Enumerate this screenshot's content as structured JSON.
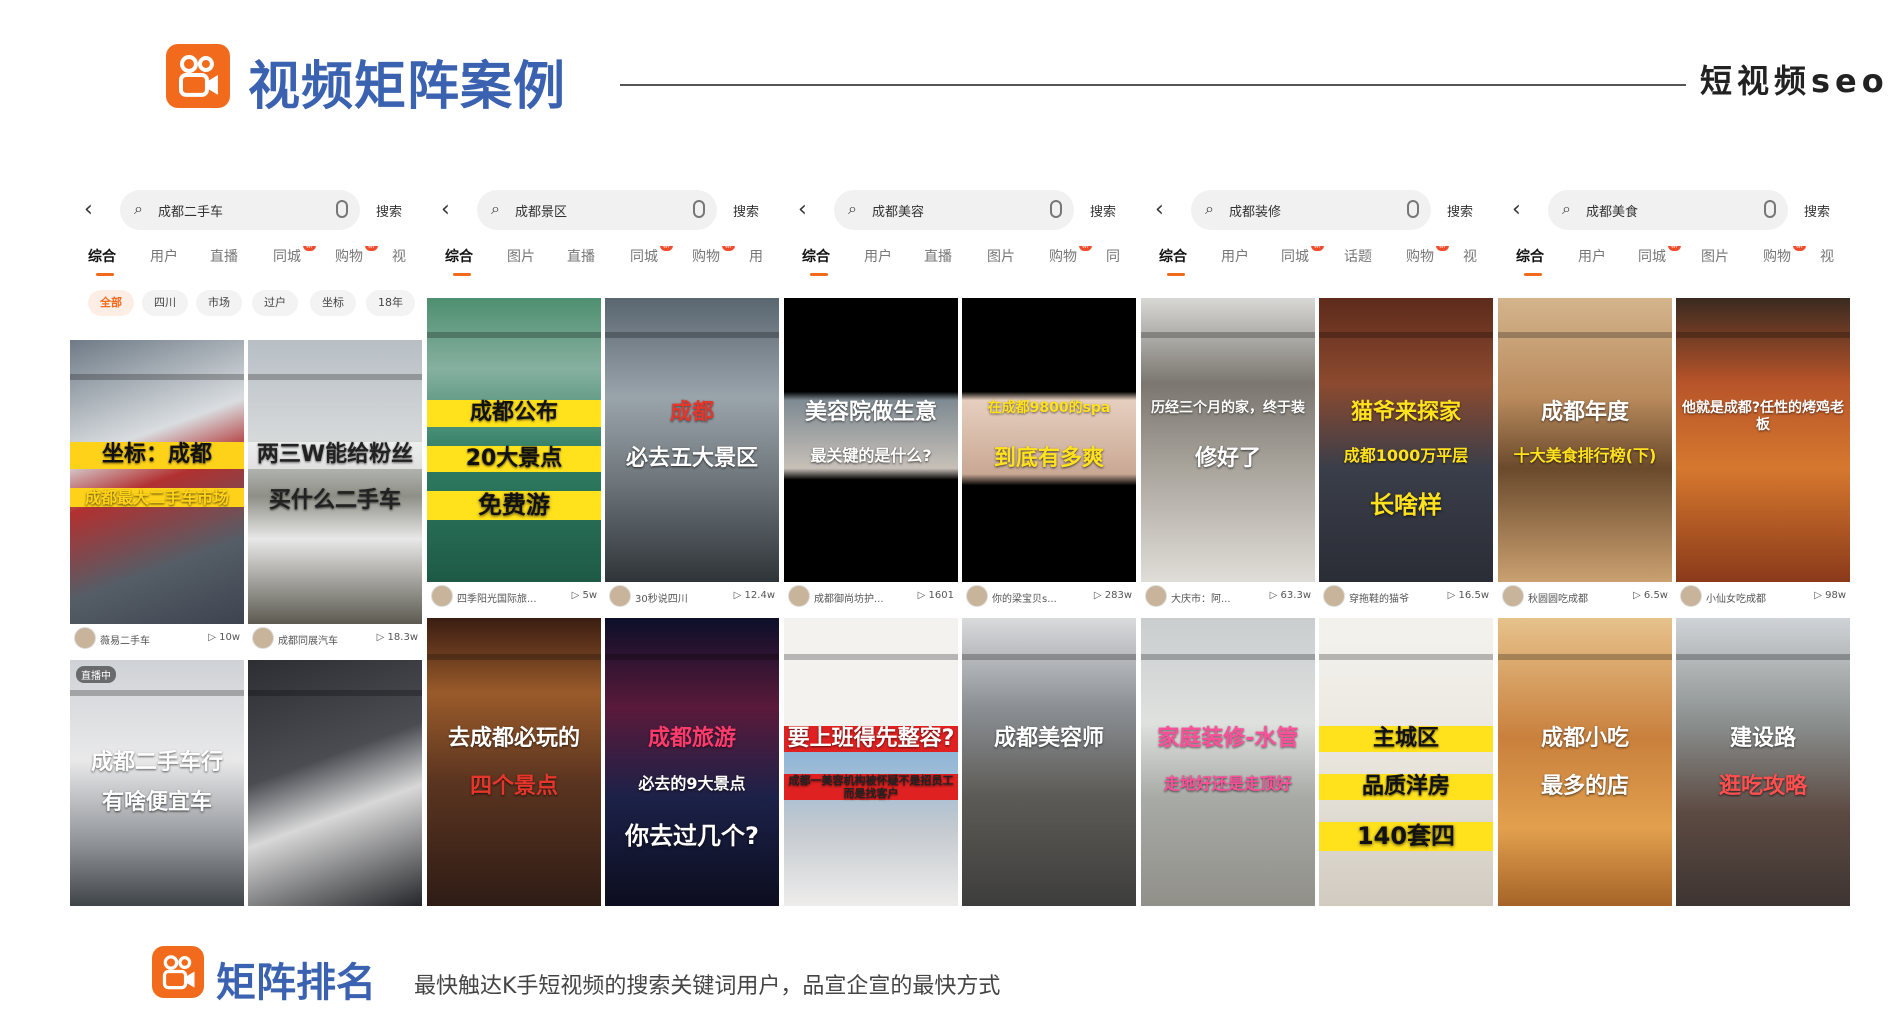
{
  "header": {
    "title": "视频矩阵案例",
    "right_text": "短视频seo"
  },
  "footer": {
    "title": "矩阵排名",
    "description": "最快触达K手短视频的搜索关键词用户，品宣企宣的最快方式"
  },
  "panels": [
    {
      "query": "成都二手车",
      "search_btn": "搜索",
      "tabs": [
        {
          "label": "综合",
          "active": true
        },
        {
          "label": "用户"
        },
        {
          "label": "直播"
        },
        {
          "label": "同城",
          "new": "新"
        },
        {
          "label": "购物",
          "new": "新"
        },
        {
          "label": "视"
        }
      ],
      "filters": [
        {
          "label": "全部",
          "active": true
        },
        {
          "label": "四川"
        },
        {
          "label": "市场"
        },
        {
          "label": "过户"
        },
        {
          "label": "坐标"
        },
        {
          "label": "18年"
        }
      ],
      "cards": [
        {
          "bg": "linear-gradient(160deg,#6e7a86,#d9dde0 35%,#b23030 50%,#555d66 75%,#3d4450)",
          "overlay": "坐标：成都",
          "overlay2": "成都最大二手车市场",
          "color": "#111",
          "color2": "#ffd21a",
          "hl": "#ffd21a",
          "author": "薇易二手车",
          "views": "10w"
        },
        {
          "bg": "linear-gradient(180deg,#b7bec4 0%,#d6d9da 35%,#8e8f86 55%,#e8e8e8 70%,#5c5a50)",
          "overlay": "两三W能给粉丝",
          "overlay2": "买什么二手车",
          "color": "#222",
          "color2": "#222",
          "hl": "rgba(255,255,255,0.6)",
          "author": "成都同展汽车",
          "views": "18.3w"
        },
        {
          "bg": "linear-gradient(180deg,#cfd2d6 0%,#e9e9ea 40%,#8a8e93 75%,#3a3f44)",
          "overlay": "成都二手车行",
          "overlay2": "有啥便宜车",
          "color": "#fff",
          "color2": "#fff",
          "hl": "rgba(0,0,0,0)",
          "author": "",
          "views": "",
          "live": "直播中"
        },
        {
          "bg": "linear-gradient(160deg,#2c2e33,#4a4c52 40%,#d8d8d8 60%,#1f2024)",
          "overlay": "",
          "overlay2": "",
          "color": "#fff",
          "color2": "#fff",
          "hl": "rgba(0,0,0,0)",
          "author": "",
          "views": ""
        }
      ]
    },
    {
      "query": "成都景区",
      "search_btn": "搜索",
      "tabs": [
        {
          "label": "综合",
          "active": true
        },
        {
          "label": "图片"
        },
        {
          "label": "直播"
        },
        {
          "label": "同城",
          "new": "新"
        },
        {
          "label": "购物",
          "new": "新"
        },
        {
          "label": "用"
        }
      ],
      "filters": [],
      "cards": [
        {
          "bg": "linear-gradient(180deg,#4e8f70 0%,#86b0a0 25%,#2f7e63 55%,#1e5a46)",
          "overlay": "成都公布",
          "overlay2": "20大景点",
          "overlay3": "免费游",
          "color": "#111",
          "color2": "#111",
          "hl": "#ffe11c",
          "author": "四季阳光国际旅...",
          "views": "5w"
        },
        {
          "bg": "linear-gradient(180deg,#5a6670 0%,#9aa4ab 35%,#6d757a 65%,#2f3438)",
          "overlay": "成都",
          "overlay2": "必去五大景区",
          "color": "#e4362b",
          "color2": "#fff",
          "hl": "rgba(0,0,0,0)",
          "author": "30秒说四川",
          "views": "12.4w"
        },
        {
          "bg": "linear-gradient(180deg,#3a1d12 0%,#9a5b2a 25%,#5a3420 55%,#2a1a14)",
          "overlay": "去成都必玩的",
          "overlay2": "四个景点",
          "color": "#fff",
          "color2": "#e4362b",
          "hl": "rgba(0,0,0,0)",
          "author": "",
          "views": ""
        },
        {
          "bg": "linear-gradient(180deg,#0c0f2a 0%,#5a1a3a 30%,#1c2148 60%,#0a0b1a)",
          "overlay": "成都旅游",
          "overlay2": "必去的9大景点",
          "overlay3": "你去过几个?",
          "color": "#ff3b6b",
          "color2": "#fff",
          "hl": "rgba(0,0,0,0)",
          "author": "",
          "views": ""
        }
      ]
    },
    {
      "query": "成都美容",
      "search_btn": "搜索",
      "tabs": [
        {
          "label": "综合",
          "active": true
        },
        {
          "label": "用户"
        },
        {
          "label": "直播"
        },
        {
          "label": "图片"
        },
        {
          "label": "购物",
          "new": "新"
        },
        {
          "label": "同"
        }
      ],
      "filters": [],
      "cards": [
        {
          "bg": "linear-gradient(180deg,#000 0%,#000 33%,#7e8a92 36%,#c7c0b8 60%,#000 64%,#000)",
          "overlay": "美容院做生意",
          "overlay2": "最关键的是什么?",
          "color": "#fff",
          "color2": "#fff",
          "hl": "rgba(0,0,0,0)",
          "author": "成都御尚坊护...",
          "views": "1601"
        },
        {
          "bg": "linear-gradient(180deg,#000 0%,#000 33%,#e6cfbf 36%,#c9a894 62%,#000 66%,#000)",
          "overlay": "在成都9800的spa",
          "overlay2": "到底有多爽",
          "color": "#ffe11c",
          "color2": "#ffe11c",
          "hl": "rgba(0,0,0,0)",
          "author": "你的梁宝贝s...",
          "views": "283w"
        },
        {
          "bg": "linear-gradient(180deg,#f4f2ef 0%,#f4f2ef 40%,#8fb6d8 45%,#c3c9cf 70%,#f4f2ef)",
          "overlay": "要上班得先整容?",
          "overlay2": "成都一美容机构被怀疑不是招员工而是找客户",
          "color": "#fff",
          "color2": "#222",
          "hl": "#e02121",
          "author": "",
          "views": ""
        },
        {
          "bg": "linear-gradient(180deg,#d9dadc 0%,#8b8f94 30%,#5c5a55 60%,#3a3a3a)",
          "overlay": "成都美容师",
          "overlay2": "",
          "color": "#fff",
          "color2": "#fff",
          "hl": "rgba(0,0,0,0)",
          "author": "",
          "views": ""
        }
      ]
    },
    {
      "query": "成都装修",
      "search_btn": "搜索",
      "tabs": [
        {
          "label": "综合",
          "active": true
        },
        {
          "label": "用户"
        },
        {
          "label": "同城",
          "new": "新"
        },
        {
          "label": "话题"
        },
        {
          "label": "购物",
          "new": "新"
        },
        {
          "label": "视"
        }
      ],
      "filters": [],
      "cards": [
        {
          "bg": "linear-gradient(180deg,#d8d8d6 0%,#7b7770 30%,#a9a49c 60%,#e0ddd8)",
          "overlay": "历经三个月的家，终于装",
          "overlay2": "修好了",
          "color": "#fff",
          "color2": "#fff",
          "hl": "rgba(0,0,0,0)",
          "author": "大庆市：阿...",
          "views": "63.3w"
        },
        {
          "bg": "linear-gradient(180deg,#5e2b1c 0%,#8c4a2f 30%,#3a3e4a 60%,#2a2d35)",
          "overlay": "猫爷来探家",
          "overlay2": "成都1000万平层",
          "overlay3": "长啥样",
          "color": "#ffe11c",
          "color2": "#ffe11c",
          "hl": "rgba(0,0,0,0)",
          "author": "穿拖鞋的猫爷",
          "views": "16.5w"
        },
        {
          "bg": "linear-gradient(180deg,#c9cdce 0%,#dfe1df 35%,#a8aaa6 60%,#8e8d86)",
          "overlay": "家庭装修-水管",
          "overlay2": "走地好还是走顶好",
          "color": "#ff4f9a",
          "color2": "#ff4f9a",
          "hl": "rgba(0,0,0,0)",
          "author": "",
          "views": ""
        },
        {
          "bg": "linear-gradient(180deg,#f3f1ec 0%,#f3f1ec 8%,#e8e4dc 50%,#cfc9be)",
          "overlay": "主城区",
          "overlay2": "品质洋房",
          "overlay3": "140套四",
          "color": "#111",
          "color2": "#111",
          "hl": "#ffe11c",
          "author": "",
          "views": ""
        }
      ]
    },
    {
      "query": "成都美食",
      "search_btn": "搜索",
      "tabs": [
        {
          "label": "综合",
          "active": true
        },
        {
          "label": "用户"
        },
        {
          "label": "同城",
          "new": "新"
        },
        {
          "label": "图片"
        },
        {
          "label": "购物",
          "new": "新"
        },
        {
          "label": "视"
        }
      ],
      "filters": [],
      "cards": [
        {
          "bg": "linear-gradient(180deg,#d4b48c 0%,#b98a5c 35%,#6a4a2c 60%,#caa070)",
          "overlay": "成都年度",
          "overlay2": "十大美食排行榜(下)",
          "color": "#fff",
          "color2": "#ffe11c",
          "hl": "rgba(0,0,0,0)",
          "author": "秋圆圆吃成都",
          "views": "6.5w"
        },
        {
          "bg": "linear-gradient(180deg,#3a2a20 0%,#b8542a 30%,#d6782e 60%,#8a3a1a)",
          "overlay": "他就是成都?任性的烤鸡老板",
          "overlay2": "",
          "color": "#fff",
          "color2": "#fff",
          "hl": "rgba(0,0,0,0)",
          "author": "小仙女吃成都",
          "views": "98w"
        },
        {
          "bg": "linear-gradient(180deg,#e6c28c 0%,#c9803c 40%,#e2a04e 70%,#9c5a22)",
          "overlay": "成都小吃",
          "overlay2": "最多的店",
          "color": "#fff",
          "color2": "#fff",
          "hl": "rgba(0,0,0,0)",
          "author": "",
          "views": ""
        },
        {
          "bg": "linear-gradient(180deg,#cfd3d7 0%,#8a8f8e 35%,#5c4a42 65%,#3a3230)",
          "overlay": "建设路",
          "overlay2": "逛吃攻略",
          "color": "#fff",
          "color2": "#ff4f4f",
          "hl": "rgba(0,0,0,0)",
          "author": "",
          "views": ""
        }
      ]
    }
  ]
}
